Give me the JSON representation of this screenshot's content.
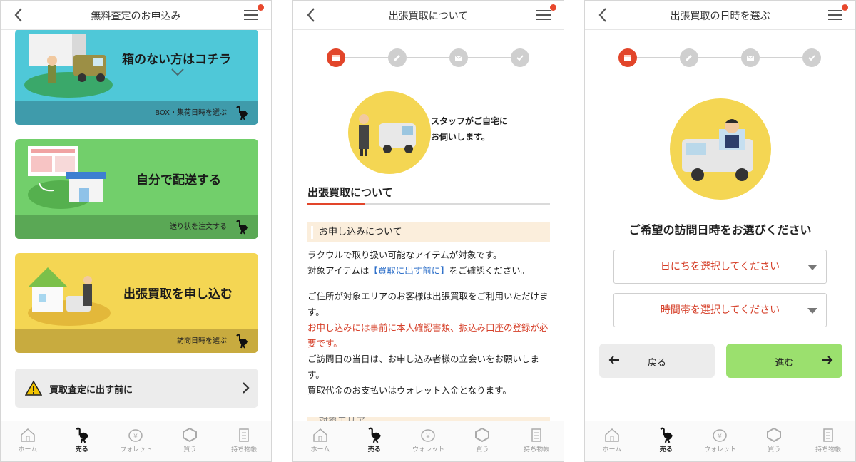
{
  "icons": {
    "back": "chevron-left-icon",
    "menu": "hamburger-menu-icon",
    "notification": "notification-dot-icon",
    "ostrich": "ostrich-icon",
    "warning": "warning-icon",
    "calendar": "calendar-icon",
    "pencil": "pencil-icon",
    "mail": "mail-icon",
    "check": "check-icon",
    "arrow_left": "arrow-left-icon",
    "arrow_right": "arrow-right-icon"
  },
  "colors": {
    "accent": "#e2452a",
    "card_blue": "#4fc8d8",
    "card_green": "#72cf6b",
    "card_yellow": "#f4d653",
    "next_button": "#9be06e"
  },
  "bottom_nav": [
    {
      "label": "ホーム",
      "icon": "home-icon"
    },
    {
      "label": "売る",
      "icon": "ostrich-icon"
    },
    {
      "label": "ウォレット",
      "icon": "wallet-icon"
    },
    {
      "label": "買う",
      "icon": "buy-icon"
    },
    {
      "label": "持ち物帳",
      "icon": "clipboard-icon"
    }
  ],
  "panel1": {
    "title": "無料査定のお申込み",
    "cards": [
      {
        "title": "箱のない方はコチラ",
        "caption": "BOX・集荷日時を選ぶ"
      },
      {
        "title": "自分で配送する",
        "caption": "送り状を注文する"
      },
      {
        "title": "出張買取を申し込む",
        "caption": "訪問日時を選ぶ"
      }
    ],
    "notice": "買取査定に出す前に"
  },
  "panel2": {
    "title": "出張買取について",
    "bubble_text_1": "スタッフがご自宅に",
    "bubble_text_2": "お伺いします。",
    "heading": "出張買取について",
    "subheading": "お申し込みについて",
    "p1_line1": "ラクウルで取り扱い可能なアイテムが対象です。",
    "p1_line2_prefix": "対象アイテムは",
    "p1_line2_link": "【買取に出す前に】",
    "p1_line2_suffix": "をご確認ください。",
    "p2_a": "ご住所が対象エリアのお客様は出張買取をご利用いただけます。",
    "p2_red": "お申し込みには事前に本人確認書類、振込み口座の登録が必要です。",
    "p2_b": "ご訪問日の当日は、お申し込み者様の立会いをお願いします。",
    "p2_c": "買取代金のお支払いはウォレット入金となります。",
    "cut_heading": "対象エリア"
  },
  "panel3": {
    "title": "出張買取の日時を選ぶ",
    "heading": "ご希望の訪問日時をお選びください",
    "date_select": "日にちを選択してください",
    "time_select": "時間帯を選択してください",
    "back_label": "戻る",
    "next_label": "進む"
  }
}
